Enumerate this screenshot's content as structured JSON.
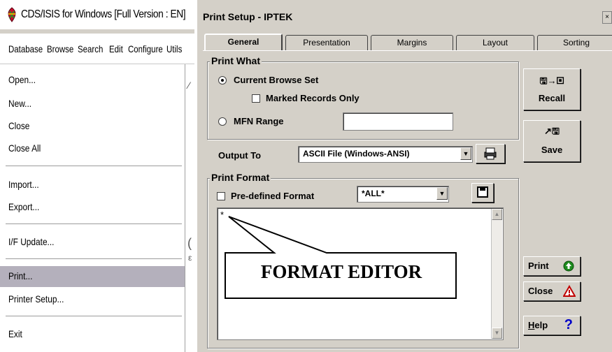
{
  "app": {
    "title": "CDS/ISIS for Windows [Full Version : EN]",
    "menubar": [
      "Database",
      "Browse",
      "Search",
      "Edit",
      "Configure",
      "Utils"
    ],
    "dropdown": [
      {
        "label": "Open...",
        "active": false
      },
      {
        "label": "New...",
        "active": false
      },
      {
        "label": "Close",
        "active": false
      },
      {
        "label": "Close All",
        "active": false
      },
      {
        "label": "Import...",
        "active": false
      },
      {
        "label": "Export...",
        "active": false
      },
      {
        "label": "I/F Update...",
        "active": false
      },
      {
        "label": "Print...",
        "active": true
      },
      {
        "label": "Printer Setup...",
        "active": false
      },
      {
        "label": "Exit",
        "active": false
      }
    ],
    "highlight_color": "#b4b0bc"
  },
  "dialog": {
    "title": "Print Setup - IPTEK",
    "tabs": [
      "General",
      "Presentation",
      "Margins",
      "Layout",
      "Sorting"
    ],
    "active_tab": "General",
    "print_what": {
      "label": "Print What",
      "current_browse_set": "Current Browse Set",
      "marked_records_only": "Marked Records Only",
      "mfn_range": "MFN Range",
      "mfn_range_value": ""
    },
    "output_to": {
      "label": "Output To",
      "value": "ASCII File (Windows-ANSI)"
    },
    "print_format": {
      "label": "Print Format",
      "predefined_format": "Pre-defined Format",
      "format_value": "*ALL*",
      "editor_text": "*"
    },
    "buttons": {
      "recall": "Recall",
      "save": "Save",
      "print": "Print",
      "close": "Close",
      "help": "Help",
      "help_mnemonic": "H",
      "help_rest": "elp"
    },
    "callout": "FORMAT EDITOR"
  }
}
